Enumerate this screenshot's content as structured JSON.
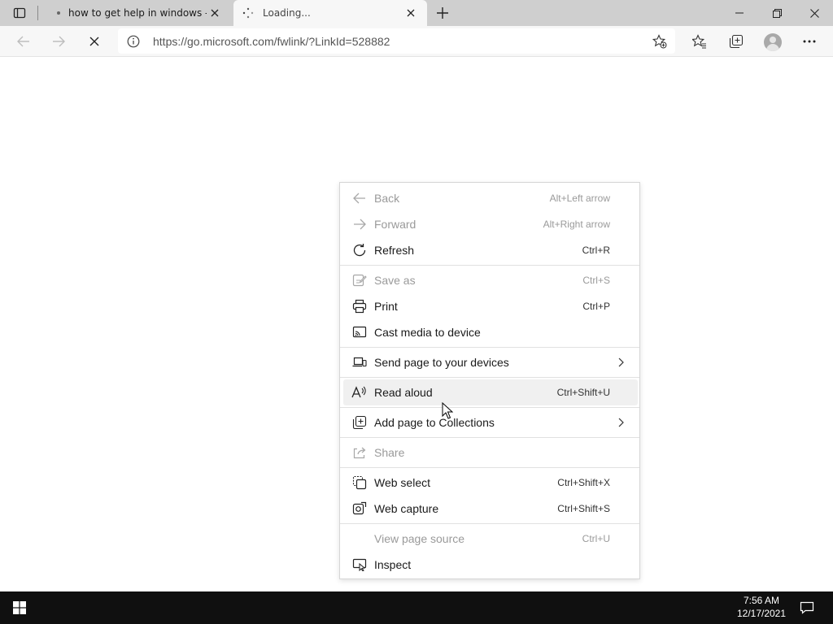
{
  "browser": {
    "tabs": [
      {
        "title": "how to get help in windows - Se",
        "active": false
      },
      {
        "title": "Loading...",
        "active": true
      }
    ],
    "address": {
      "url": "https://go.microsoft.com/fwlink/?LinkId=528882"
    }
  },
  "icons": {
    "tab_actions": "tab-actions-icon",
    "new_tab": "plus-icon",
    "back": "arrow-left-icon",
    "forward": "arrow-right-icon",
    "stop": "close-icon",
    "info": "info-icon",
    "add_favorite": "star-plus-icon",
    "favorites": "favorites-icon",
    "collections": "collections-icon",
    "profile": "avatar",
    "more": "ellipsis-icon"
  },
  "context_menu": {
    "items": [
      {
        "label": "Back",
        "shortcut": "Alt+Left arrow",
        "icon": "arrow-left-icon",
        "disabled": true
      },
      {
        "label": "Forward",
        "shortcut": "Alt+Right arrow",
        "icon": "arrow-right-icon",
        "disabled": true
      },
      {
        "label": "Refresh",
        "shortcut": "Ctrl+R",
        "icon": "refresh-icon",
        "disabled": false
      },
      {
        "label": "Save as",
        "shortcut": "Ctrl+S",
        "icon": "save-as-icon",
        "disabled": true
      },
      {
        "label": "Print",
        "shortcut": "Ctrl+P",
        "icon": "print-icon",
        "disabled": false
      },
      {
        "label": "Cast media to device",
        "shortcut": "",
        "icon": "cast-icon",
        "disabled": false
      },
      {
        "label": "Send page to your devices",
        "shortcut": "",
        "icon": "send-to-device-icon",
        "disabled": false,
        "submenu": true
      },
      {
        "label": "Read aloud",
        "shortcut": "Ctrl+Shift+U",
        "icon": "read-aloud-icon",
        "disabled": false,
        "hover": true
      },
      {
        "label": "Add page to Collections",
        "shortcut": "",
        "icon": "collections-add-icon",
        "disabled": false,
        "submenu": true
      },
      {
        "label": "Share",
        "shortcut": "",
        "icon": "share-icon",
        "disabled": true
      },
      {
        "label": "Web select",
        "shortcut": "Ctrl+Shift+X",
        "icon": "web-select-icon",
        "disabled": false
      },
      {
        "label": "Web capture",
        "shortcut": "Ctrl+Shift+S",
        "icon": "web-capture-icon",
        "disabled": false
      },
      {
        "label": "View page source",
        "shortcut": "Ctrl+U",
        "icon": "",
        "disabled": true
      },
      {
        "label": "Inspect",
        "shortcut": "",
        "icon": "inspect-icon",
        "disabled": false
      }
    ]
  },
  "taskbar": {
    "time": "7:56 AM",
    "date": "12/17/2021"
  }
}
